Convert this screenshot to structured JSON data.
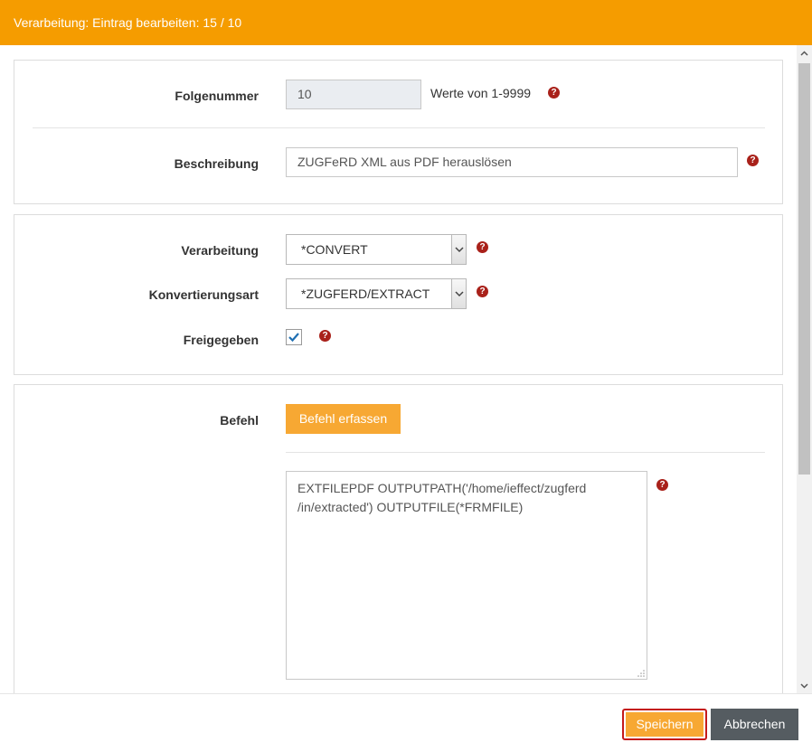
{
  "dialog": {
    "title": "Verarbeitung: Eintrag bearbeiten: 15 / 10"
  },
  "form": {
    "sequence": {
      "label": "Folgenummer",
      "value": "10",
      "hint": "Werte von 1-9999"
    },
    "description": {
      "label": "Beschreibung",
      "value": "ZUGFeRD XML aus PDF herauslösen"
    },
    "processing": {
      "label": "Verarbeitung",
      "selected": "*CONVERT"
    },
    "conversion_type": {
      "label": "Konvertierungsart",
      "selected": "*ZUGFERD/EXTRACT"
    },
    "released": {
      "label": "Freigegeben",
      "checked": true
    },
    "command": {
      "label": "Befehl",
      "capture_button": "Befehl erfassen",
      "text_line1": "EXTFILEPDF OUTPUTPATH('/home/ieffect/zugferd",
      "text_line2": "/in/extracted') OUTPUTFILE(*FRMFILE)"
    }
  },
  "help_icon_glyph": "?",
  "footer": {
    "save_label": "Speichern",
    "cancel_label": "Abbrechen"
  },
  "colors": {
    "header": "#f59c00",
    "primary_button": "#f7a833",
    "secondary_button": "#555c61",
    "help_icon": "#a9211a",
    "focus_outline": "#c41a1a"
  }
}
